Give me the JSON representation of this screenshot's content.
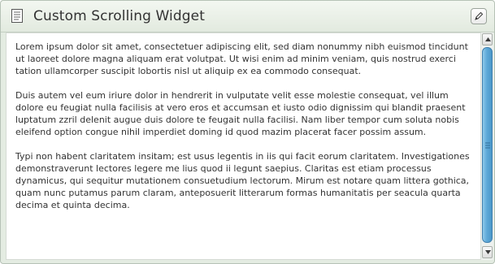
{
  "widget": {
    "title": "Custom Scrolling Widget",
    "icons": {
      "header": "document-icon",
      "edit": "pencil-icon"
    },
    "paragraphs": [
      "Lorem ipsum dolor sit amet, consectetuer adipiscing elit, sed diam nonummy nibh euismod tincidunt ut laoreet dolore magna aliquam erat volutpat. Ut wisi enim ad minim veniam, quis nostrud exerci tation ullamcorper suscipit lobortis nisl ut aliquip ex ea commodo consequat.",
      "Duis autem vel eum iriure dolor in hendrerit in vulputate velit esse molestie consequat, vel illum dolore eu feugiat nulla facilisis at vero eros et accumsan et iusto odio dignissim qui blandit praesent luptatum zzril delenit augue duis dolore te feugait nulla facilisi. Nam liber tempor cum soluta nobis eleifend option congue nihil imperdiet doming id quod mazim placerat facer possim assum.",
      "Typi non habent claritatem insitam; est usus legentis in iis qui facit eorum claritatem. Investigationes demonstraverunt lectores legere me lius quod ii legunt saepius. Claritas est etiam processus dynamicus, qui sequitur mutationem consuetudium lectorum. Mirum est notare quam littera gothica, quam nunc putamus parum claram, anteposuerit litterarum formas humanitatis per seacula quarta decima et quinta decima."
    ]
  },
  "colors": {
    "header_bg": "#e8efe5",
    "scroll_thumb": "#5ea9d8",
    "text": "#333333"
  }
}
